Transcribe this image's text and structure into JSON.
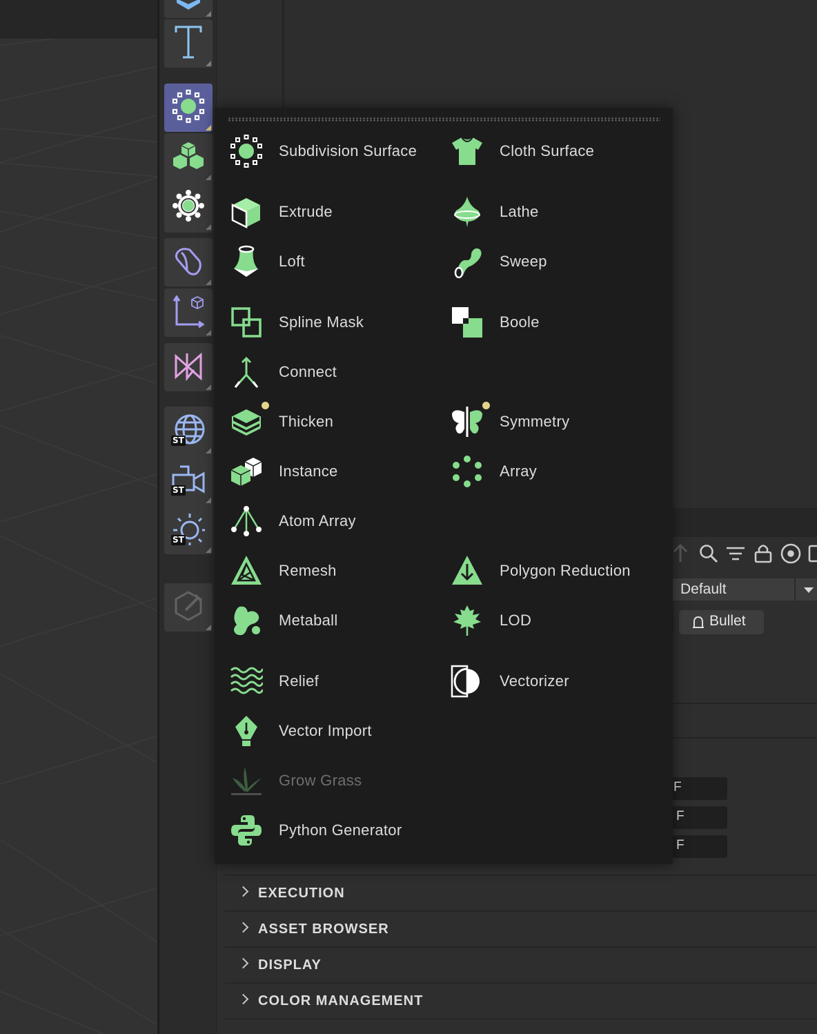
{
  "colors": {
    "accent_green": "#87dc8e",
    "active_tool": "#5a5f9c",
    "new_dot": "#e2d58a",
    "popup_bg": "#1c1c1c"
  },
  "toolbar": {
    "buttons": [
      {
        "name": "cube",
        "icon": "cube-icon"
      },
      {
        "name": "text",
        "icon": "text-icon"
      },
      {
        "name": "subdivision-surface",
        "icon": "subdivision-surface-icon",
        "active": true
      },
      {
        "name": "cloner",
        "icon": "cloner-icon"
      },
      {
        "name": "effector",
        "icon": "effector-icon"
      },
      {
        "name": "deformer",
        "icon": "deformer-icon"
      },
      {
        "name": "field",
        "icon": "field-icon"
      },
      {
        "name": "volume",
        "icon": "volume-icon"
      },
      {
        "name": "environment",
        "icon": "environment-icon",
        "badge": "ST"
      },
      {
        "name": "camera",
        "icon": "camera-icon",
        "badge": "ST"
      },
      {
        "name": "light",
        "icon": "light-icon",
        "badge": "ST"
      },
      {
        "name": "edit",
        "icon": "edit-icon"
      }
    ]
  },
  "popup": {
    "items": [
      {
        "label": "Subdivision Surface",
        "icon": "subdivision-surface-icon"
      },
      {
        "label": "Cloth Surface",
        "icon": "cloth-surface-icon"
      },
      {
        "label": "Extrude",
        "icon": "extrude-icon"
      },
      {
        "label": "Lathe",
        "icon": "lathe-icon"
      },
      {
        "label": "Loft",
        "icon": "loft-icon"
      },
      {
        "label": "Sweep",
        "icon": "sweep-icon"
      },
      {
        "label": "Spline Mask",
        "icon": "spline-mask-icon"
      },
      {
        "label": "Boole",
        "icon": "boole-icon"
      },
      {
        "label": "Connect",
        "icon": "connect-icon"
      },
      {
        "label": "Thicken",
        "icon": "thicken-icon",
        "new": true
      },
      {
        "label": "Symmetry",
        "icon": "symmetry-icon",
        "new": true
      },
      {
        "label": "Instance",
        "icon": "instance-icon"
      },
      {
        "label": "Array",
        "icon": "array-icon"
      },
      {
        "label": "Atom Array",
        "icon": "atom-array-icon"
      },
      {
        "label": "Remesh",
        "icon": "remesh-icon"
      },
      {
        "label": "Polygon Reduction",
        "icon": "polygon-reduction-icon"
      },
      {
        "label": "Metaball",
        "icon": "metaball-icon"
      },
      {
        "label": "LOD",
        "icon": "lod-icon"
      },
      {
        "label": "Relief",
        "icon": "relief-icon"
      },
      {
        "label": "Vectorizer",
        "icon": "vectorizer-icon"
      },
      {
        "label": "Vector Import",
        "icon": "vector-import-icon"
      },
      {
        "label": "Grow Grass",
        "icon": "grow-grass-icon",
        "disabled": true
      },
      {
        "label": "Python Generator",
        "icon": "python-generator-icon"
      }
    ]
  },
  "attributes": {
    "icons": [
      "up-arrow-icon",
      "search-icon",
      "filter-icon",
      "lock-icon",
      "target-icon",
      "edit-icon"
    ],
    "layer_dropdown": "Default",
    "tag": "Bullet",
    "fields": [
      "F",
      "F",
      "F"
    ],
    "sections": [
      "EXECUTION",
      "ASSET BROWSER",
      "DISPLAY",
      "COLOR MANAGEMENT"
    ]
  }
}
